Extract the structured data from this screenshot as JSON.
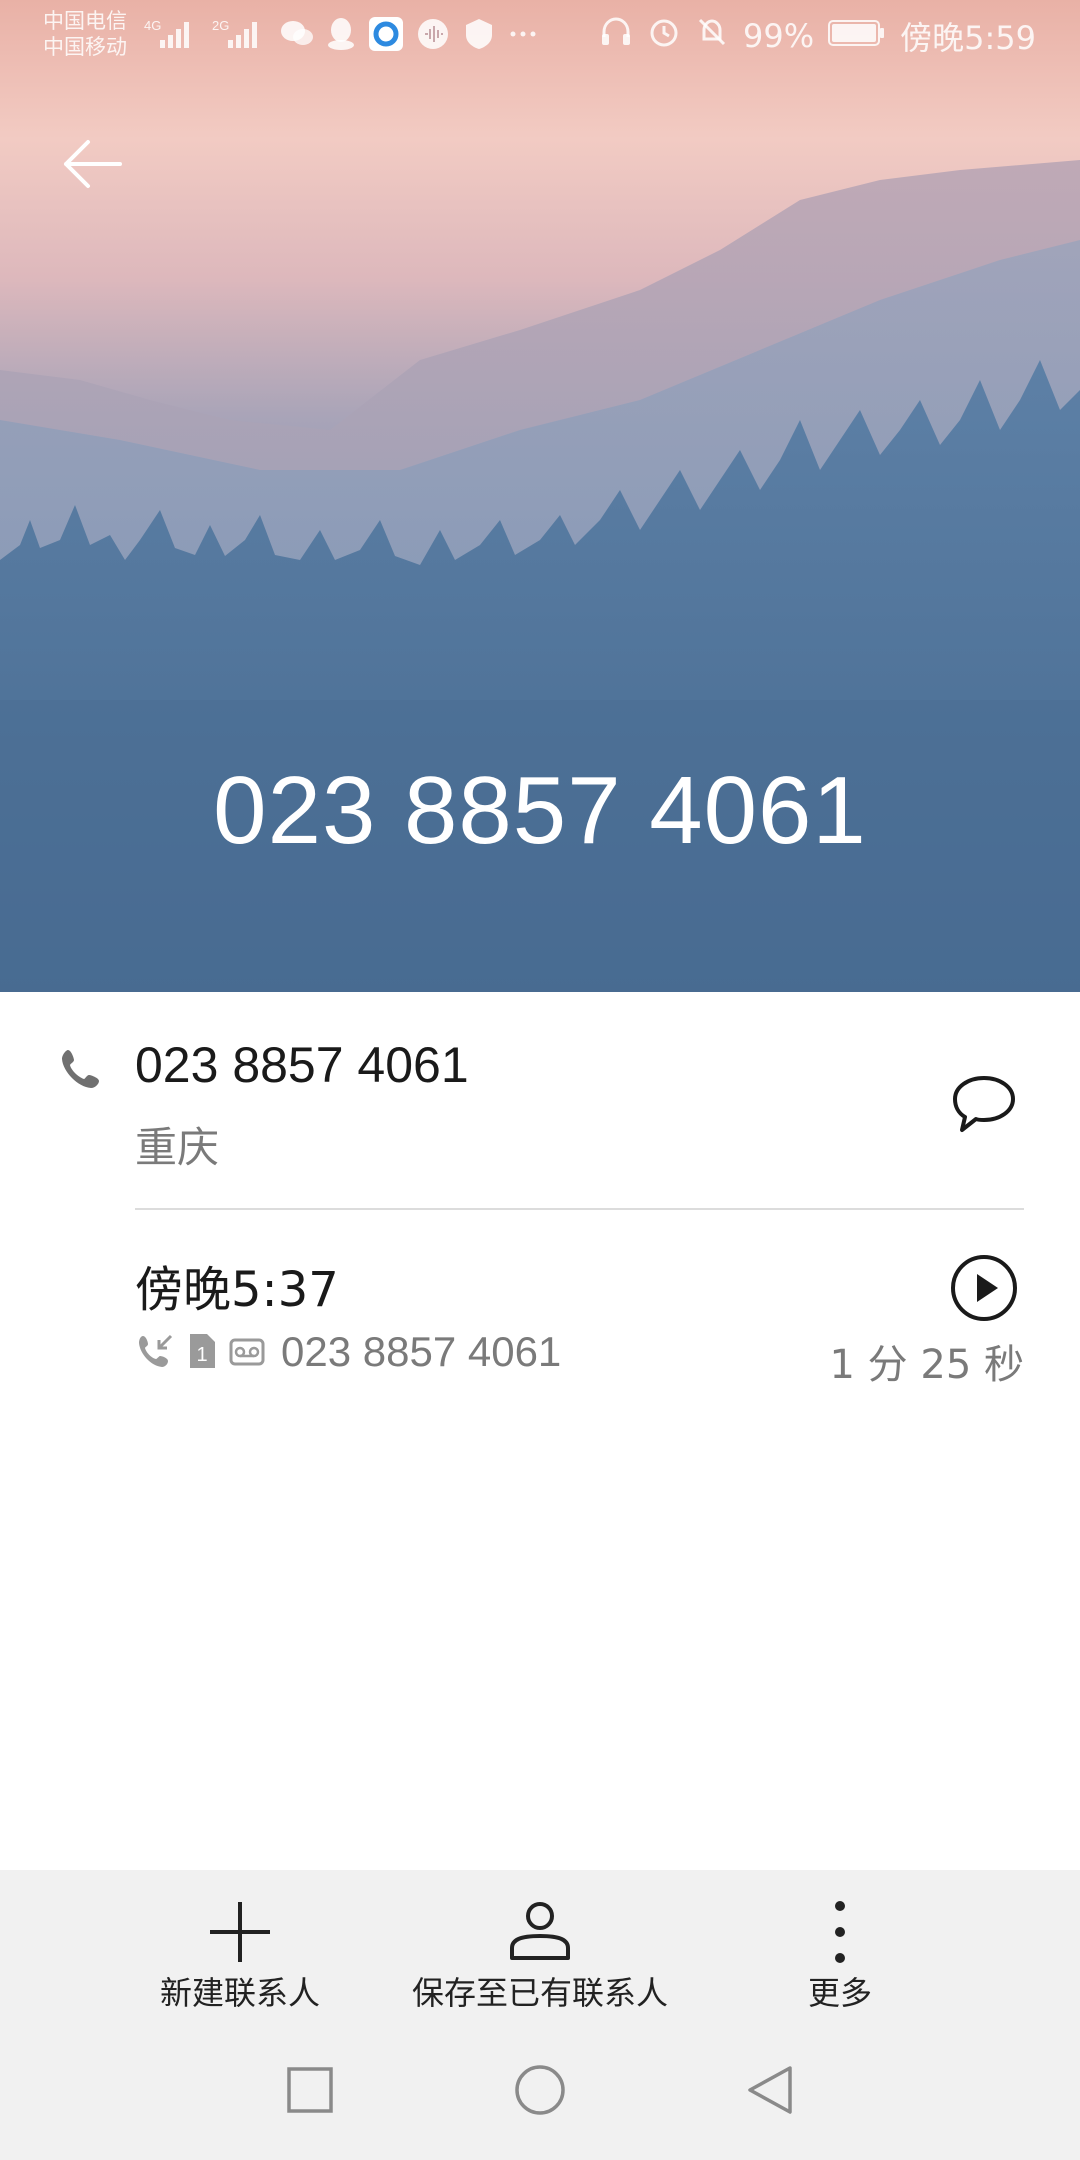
{
  "status_bar": {
    "carrier_1": "中国电信",
    "carrier_2": "中国移动",
    "net_1": "4G",
    "net_2": "2G",
    "battery": "99%",
    "time": "傍晚5:59"
  },
  "header": {
    "number": "023 8857 4061"
  },
  "contact": {
    "number": "023 8857 4061",
    "location": "重庆"
  },
  "call_log": [
    {
      "time": "傍晚5:37",
      "number": "023 8857 4061",
      "sim": "1",
      "duration": "1 分 25 秒"
    }
  ],
  "actions": {
    "new_contact": "新建联系人",
    "save_existing": "保存至已有联系人",
    "more": "更多"
  },
  "icons": {
    "back": "back-arrow-icon",
    "phone": "phone-icon",
    "message": "message-icon",
    "play": "play-icon",
    "add": "plus-icon",
    "person": "person-icon",
    "more": "more-vertical-icon"
  },
  "colors": {
    "hero_sky": "#f2cbc3",
    "hero_forest": "#4c6f96",
    "text_primary": "#1a1a1a",
    "text_secondary": "#7a7a7a",
    "bar_bg": "#f1f1f1"
  }
}
